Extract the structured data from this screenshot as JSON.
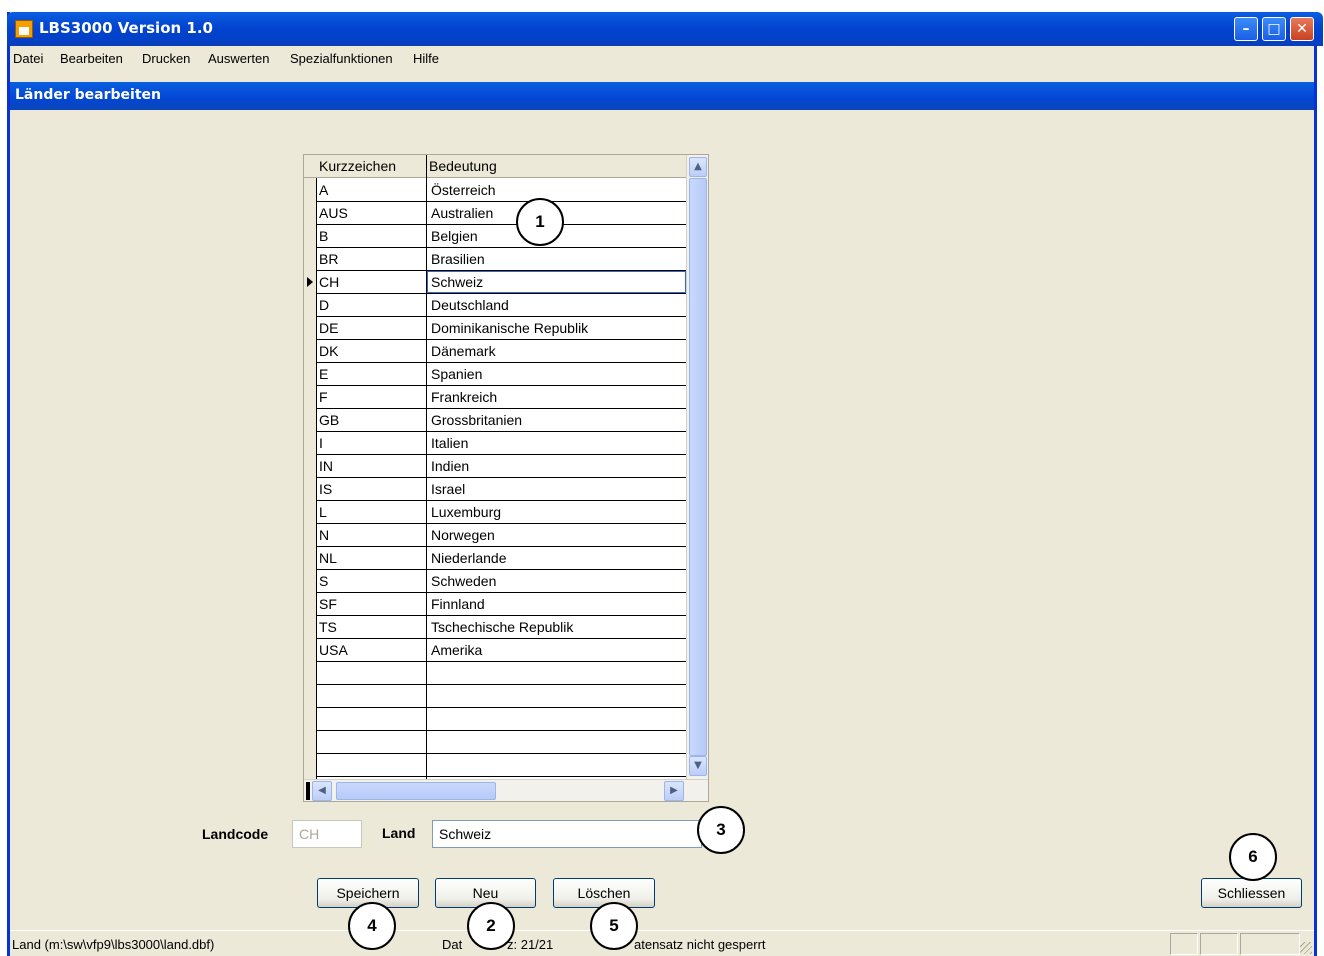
{
  "window": {
    "title": "LBS3000 Version 1.0"
  },
  "menu": [
    "Datei",
    "Bearbeiten",
    "Drucken",
    "Auswerten",
    "Spezialfunktionen",
    "Hilfe"
  ],
  "form_title": "Länder bearbeiten",
  "grid": {
    "headers": [
      "Kurzzeichen",
      "Bedeutung"
    ],
    "rows": [
      [
        "A",
        "Österreich"
      ],
      [
        "AUS",
        "Australien"
      ],
      [
        "B",
        "Belgien"
      ],
      [
        "BR",
        "Brasilien"
      ],
      [
        "CH",
        "Schweiz"
      ],
      [
        "D",
        "Deutschland"
      ],
      [
        "DE",
        "Dominikanische Republik"
      ],
      [
        "DK",
        "Dänemark"
      ],
      [
        "E",
        "Spanien"
      ],
      [
        "F",
        "Frankreich"
      ],
      [
        "GB",
        "Grossbritanien"
      ],
      [
        "I",
        "Italien"
      ],
      [
        "IN",
        "Indien"
      ],
      [
        "IS",
        "Israel"
      ],
      [
        "L",
        "Luxemburg"
      ],
      [
        "N",
        "Norwegen"
      ],
      [
        "NL",
        "Niederlande"
      ],
      [
        "S",
        "Schweden"
      ],
      [
        "SF",
        "Finnland"
      ],
      [
        "TS",
        "Tschechische Republik"
      ],
      [
        "USA",
        "Amerika"
      ],
      [
        "",
        ""
      ],
      [
        "",
        ""
      ],
      [
        "",
        ""
      ],
      [
        "",
        ""
      ],
      [
        "",
        ""
      ]
    ],
    "selected_index": 4
  },
  "fields": {
    "landcode_label": "Landcode",
    "landcode_value": "CH",
    "land_label": "Land",
    "land_value": "Schweiz"
  },
  "buttons": {
    "save": "Speichern",
    "new": "Neu",
    "delete": "Löschen",
    "close": "Schliessen"
  },
  "callouts": [
    "1",
    "2",
    "3",
    "4",
    "5",
    "6"
  ],
  "statusbar": {
    "path": "Land (m:\\sw\\vfp9\\lbs3000\\land.dbf)",
    "record_prefix": "Dat",
    "record": "z: 21/21",
    "lock_status": "atensatz nicht gesperrt"
  }
}
